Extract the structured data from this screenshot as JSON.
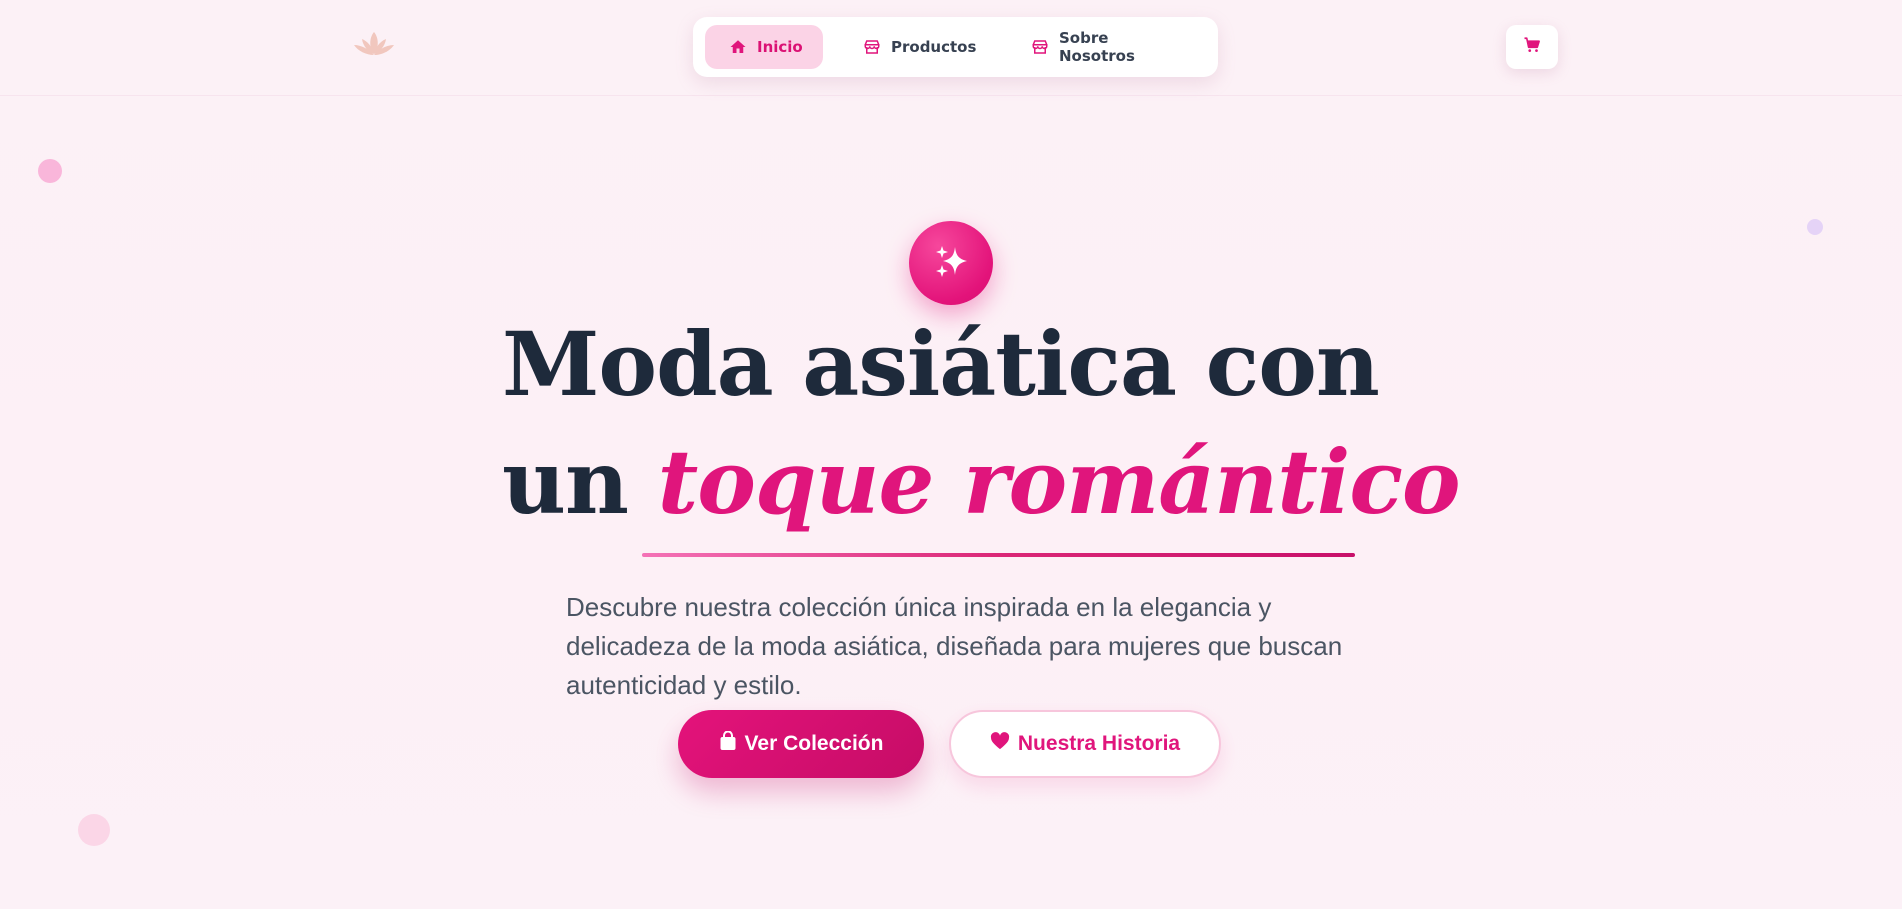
{
  "nav": {
    "items": [
      {
        "label": "Inicio",
        "icon": "home-icon",
        "active": true
      },
      {
        "label": "Productos",
        "icon": "store-icon",
        "active": false
      },
      {
        "label": "Sobre Nosotros",
        "icon": "store-icon",
        "active": false
      }
    ]
  },
  "icons": {
    "logo": "lotus-icon",
    "cart": "cart-icon",
    "hero_badge": "sparkles-icon"
  },
  "hero": {
    "title_line1": "Moda asiática con",
    "title_line2_plain": "un ",
    "title_line2_accent": "toque romántico",
    "description": "Descubre nuestra colección única inspirada en la elegancia y delicadeza de la moda asiática, diseñada para mujeres que buscan autenticidad y estilo.",
    "primary_button": "Ver Colección",
    "secondary_button": "Nuestra Historia"
  },
  "colors": {
    "accent": "#e0157c",
    "accent_dark": "#c60c66",
    "active_tab_bg": "#fbd3e6",
    "heading": "#1e2a3b",
    "background": "#fcf1f6"
  }
}
